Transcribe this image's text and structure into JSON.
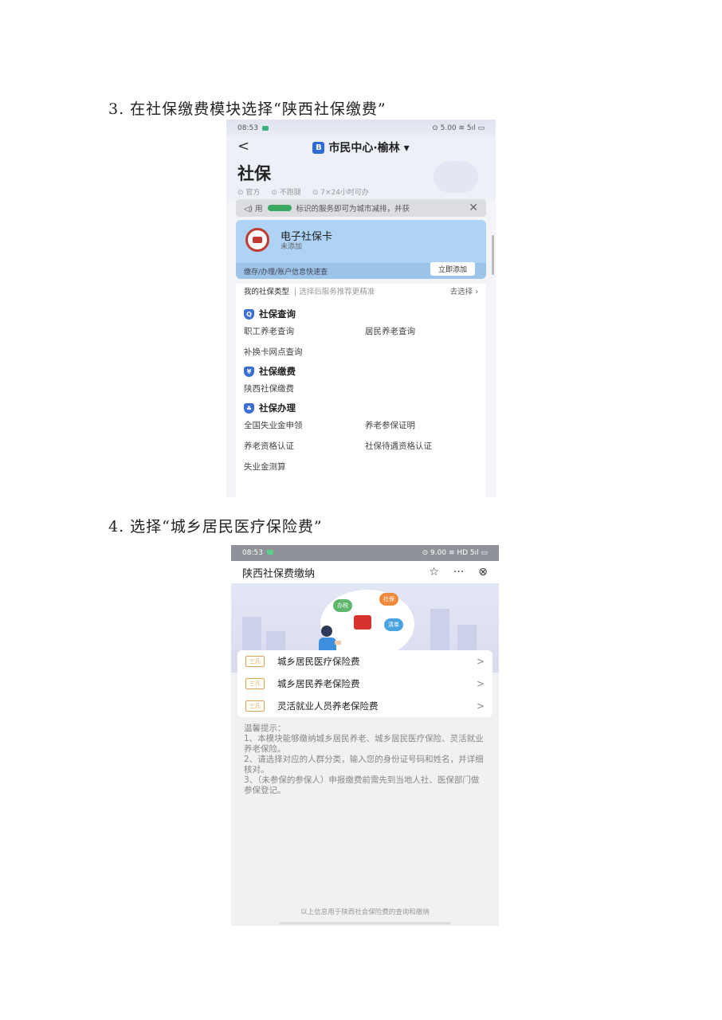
{
  "step3": {
    "label": "3. 在社保缴费模块选择“陕西社保缴费”"
  },
  "step4": {
    "label": "4. 选择“城乡居民医疗保险费”"
  },
  "phone1": {
    "status_time": "08:53",
    "status_right": "⊙ 5.00 ≋ 5ıl ▭",
    "back": "<",
    "nav_title": "市民中心·榆林 ▾",
    "page_title": "社保",
    "tags": [
      "⊙ 官方",
      "⊙ 不跑腿",
      "⊙ 7×24小时可办"
    ],
    "notice": {
      "prefix": "◁) 用",
      "text": "标识的服务即可为城市减排，并获",
      "close": "✕"
    },
    "card": {
      "title": "电子社保卡",
      "subtitle": "未添加",
      "footer": "缴存/办理/账户信息快速查",
      "add": "立即添加"
    },
    "type_bar": {
      "label": "我的社保类型",
      "hint": "| 选择后服务推荐更精准",
      "action": "去选择 ›"
    },
    "sections": [
      {
        "icon": "Q",
        "title": "社保查询",
        "items": [
          "职工养老查询",
          "居民养老查询",
          "补换卡网点查询"
        ]
      },
      {
        "icon": "¥",
        "title": "社保缴费",
        "items": [
          "陕西社保缴费"
        ]
      },
      {
        "icon": "♣",
        "title": "社保办理",
        "items": [
          "全国失业金申领",
          "养老参保证明",
          "养老资格认证",
          "社保待遇资格认证",
          "失业金测算"
        ]
      }
    ]
  },
  "phone2": {
    "status_time": "08:53",
    "status_right": "⊙ 9.00 ≋ HD 5ıl ▭",
    "title": "陕西社保费缴纳",
    "actions": [
      "☆",
      "···",
      "⊗"
    ],
    "banner_chips": [
      "办税",
      "社保",
      "清单"
    ],
    "rows": [
      {
        "icon": "三凡",
        "label": "城乡居民医疗保险费",
        "arrow": ">"
      },
      {
        "icon": "三凡",
        "label": "城乡居民养老保险费",
        "arrow": ">"
      },
      {
        "icon": "三凡",
        "label": "灵活就业人员养老保险费",
        "arrow": ">"
      }
    ],
    "tips_title": "温馨提示：",
    "tips": [
      "1、本模块能够缴纳城乡居民养老、城乡居民医疗保险、灵活就业养老保险。",
      "2、请选择对应的人群分类，输入您的身份证号码和姓名，并详细核对。",
      "3、（未参保的参保人）申报缴费前需先到当地人社、医保部门做参保登记。"
    ],
    "footer": "以上信息用于陕西社会保险费的查询和缴纳"
  }
}
